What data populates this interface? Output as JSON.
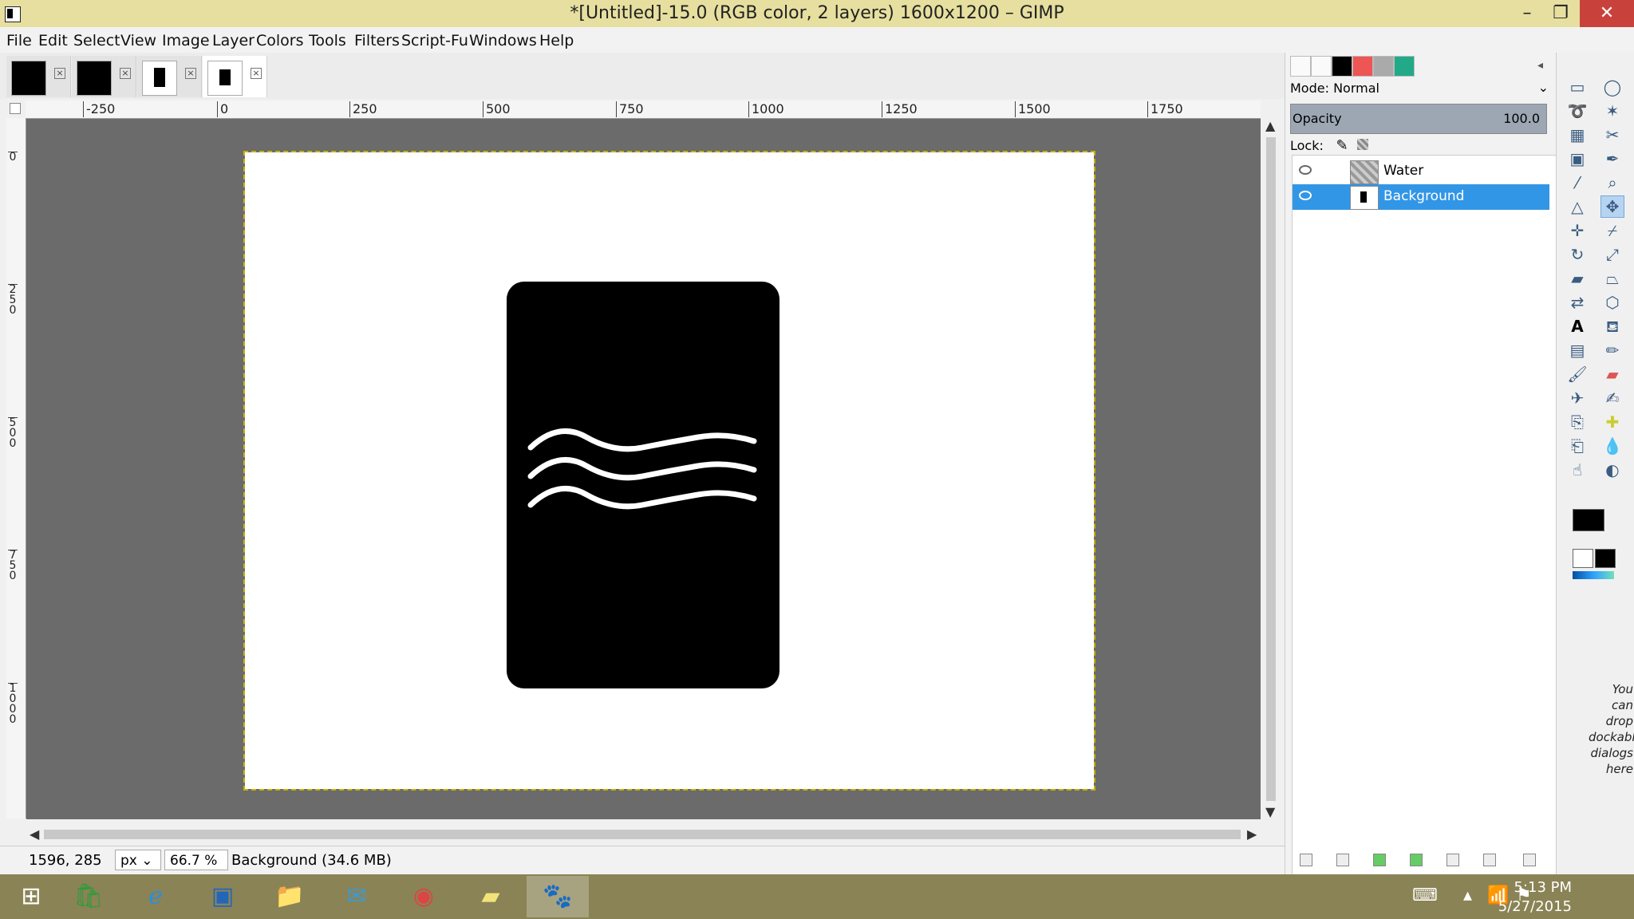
{
  "window": {
    "title": "*[Untitled]-15.0 (RGB color, 2 layers) 1600x1200 – GIMP",
    "minimize": "–",
    "maximize": "❐",
    "close": "✕"
  },
  "menu": [
    "File",
    "Edit",
    "Select",
    "View",
    "Image",
    "Layer",
    "Colors",
    "Tools",
    "Filters",
    "Script-Fu",
    "Windows",
    "Help"
  ],
  "image_tabs": [
    {
      "name": "tab-1"
    },
    {
      "name": "tab-2"
    },
    {
      "name": "tab-3"
    },
    {
      "name": "tab-4-active"
    }
  ],
  "tab_close": "×",
  "ruler": {
    "h_labels": [
      "-250",
      "0",
      "250",
      "500",
      "750",
      "1000",
      "1250",
      "1500",
      "1750"
    ],
    "v_labels": [
      "0",
      "250",
      "500",
      "750",
      "1000"
    ]
  },
  "status": {
    "coords": "1596, 285",
    "unit": "px",
    "zoom": "66.7 %",
    "message": "Background (34.6 MB)"
  },
  "layers_dock": {
    "mode_label": "Mode: Normal",
    "opacity_label": "Opacity",
    "opacity_value": "100.0",
    "lock_label": "Lock:",
    "layers": [
      {
        "name": "Water",
        "selected": false
      },
      {
        "name": "Background",
        "selected": true
      }
    ]
  },
  "toolbox": {
    "drop_hint": "You can drop dockable dialogs here"
  },
  "taskbar": {
    "time": "5:13 PM",
    "date": "5/27/2015"
  },
  "colors": {
    "titlebar": "#e6df9f",
    "selection": "#3296e6",
    "canvas_bg": "#6b6b6b",
    "taskbar": "#8a8355"
  }
}
